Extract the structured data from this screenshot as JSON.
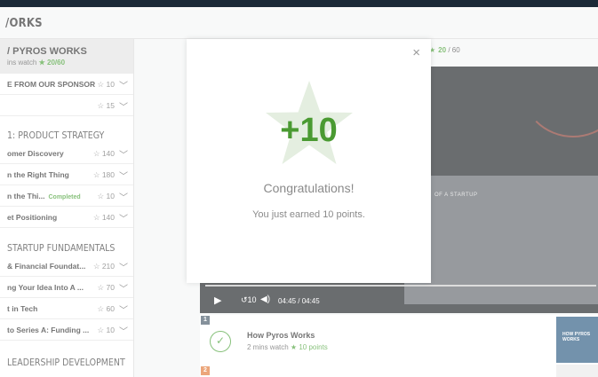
{
  "header": {
    "title": "/ORKS"
  },
  "sidebar": {
    "current": {
      "title": "/ PYROS WORKS",
      "sub": "ins watch",
      "points": "20/60"
    },
    "rows": [
      {
        "label": "E FROM OUR SPONSOR",
        "points": "10",
        "done": ""
      },
      {
        "label": "",
        "points": "15",
        "done": ""
      }
    ],
    "section1": "1: PRODUCT STRATEGY",
    "rows1": [
      {
        "label": "omer Discovery",
        "points": "140",
        "done": ""
      },
      {
        "label": "n the Right Thing",
        "points": "180",
        "done": ""
      },
      {
        "label": "n the Thi...",
        "points": "10",
        "done": "Completed"
      },
      {
        "label": "et Positioning",
        "points": "140",
        "done": ""
      }
    ],
    "section2": "STARTUP FUNDAMENTALS",
    "rows2": [
      {
        "label": "& Financial Foundat...",
        "points": "210",
        "done": ""
      },
      {
        "label": "ng Your Idea Into A ...",
        "points": "70",
        "done": ""
      },
      {
        "label": "t in Tech",
        "points": "60",
        "done": ""
      },
      {
        "label": "to Series A: Funding ...",
        "points": "10",
        "done": ""
      }
    ],
    "section3": "LEADERSHIP DEVELOPMENT"
  },
  "content": {
    "points_top": "20",
    "points_total": "/ 60",
    "video": {
      "slide_text": "OF A STARTUP",
      "time": "04:45 / 04:45",
      "rewind": "10"
    },
    "lessons": [
      {
        "num": "1",
        "title": "How Pyros Works",
        "sub": "2 mins watch",
        "points": "10 points"
      },
      {
        "num": "2"
      }
    ],
    "thumb_text": "HOW PYROS WORKS"
  },
  "modal": {
    "points": "+10",
    "congrats": "Congratulations!",
    "earned": "You just earned 10 points.",
    "star_color": "#e4eee0",
    "points_color": "#4a9a32"
  },
  "icons": [
    "close-icon",
    "star-icon",
    "chevron-down-icon",
    "play-icon",
    "volume-icon",
    "rewind-icon",
    "check-icon"
  ]
}
